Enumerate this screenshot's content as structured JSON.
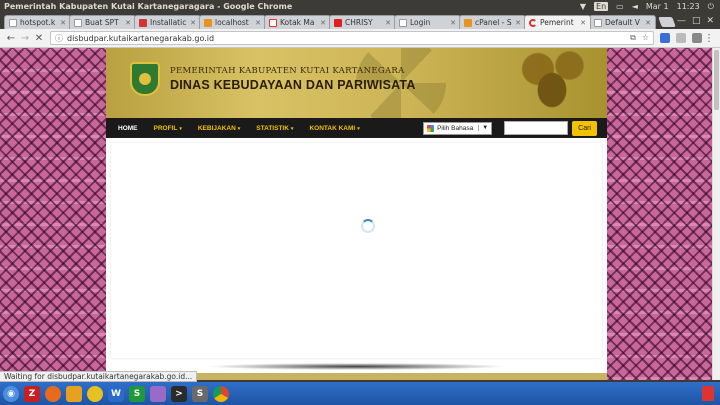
{
  "os": {
    "window_title": "Pemerintah Kabupaten Kutai Kartanegaragara - Google Chrome",
    "lang": "En",
    "date": "Mar 1",
    "time": "11:23"
  },
  "tabs": [
    {
      "label": "hotspot.k",
      "fav_color": "#ffffff"
    },
    {
      "label": "Buat SPT",
      "fav_color": "#ffffff"
    },
    {
      "label": "Installatic",
      "fav_color": "#d33333"
    },
    {
      "label": "localhost",
      "fav_color": "#e8931e"
    },
    {
      "label": "Kotak Ma",
      "fav_color": "#d33333"
    },
    {
      "label": "CHRISY",
      "fav_color": "#e02020"
    },
    {
      "label": "Login",
      "fav_color": "#ffffff"
    },
    {
      "label": "cPanel - S",
      "fav_color": "#e8931e"
    },
    {
      "label": "Pemerint",
      "fav_color": "#ffffff",
      "active": true
    },
    {
      "label": "Default V",
      "fav_color": "#ffffff"
    }
  ],
  "toolbar": {
    "url": "disbudpar.kutaikartanegarakab.go.id"
  },
  "site": {
    "header_line1": "PEMERINTAH KABUPATEN KUTAI KARTANEGARA",
    "header_line2": "DINAS KEBUDAYAAN DAN PARIWISATA",
    "nav": {
      "home": "HOME",
      "profil": "PROFIL",
      "kebijakan": "KEBIJAKAN",
      "statistik": "STATISTIK",
      "kontak": "KONTAK KAMI",
      "caret": "▾"
    },
    "translate_label": "Pilih Bahasa",
    "translate_dropdown": "▼",
    "search_button": "Cari"
  },
  "status_text": "Waiting for disbudpar.kutaikartanegarakab.go.id...",
  "colors": {
    "nav_bg": "#1a1a1a",
    "nav_text": "#f2c200",
    "banner_gold": "#cdb456",
    "background_pink": "#c9679b"
  }
}
